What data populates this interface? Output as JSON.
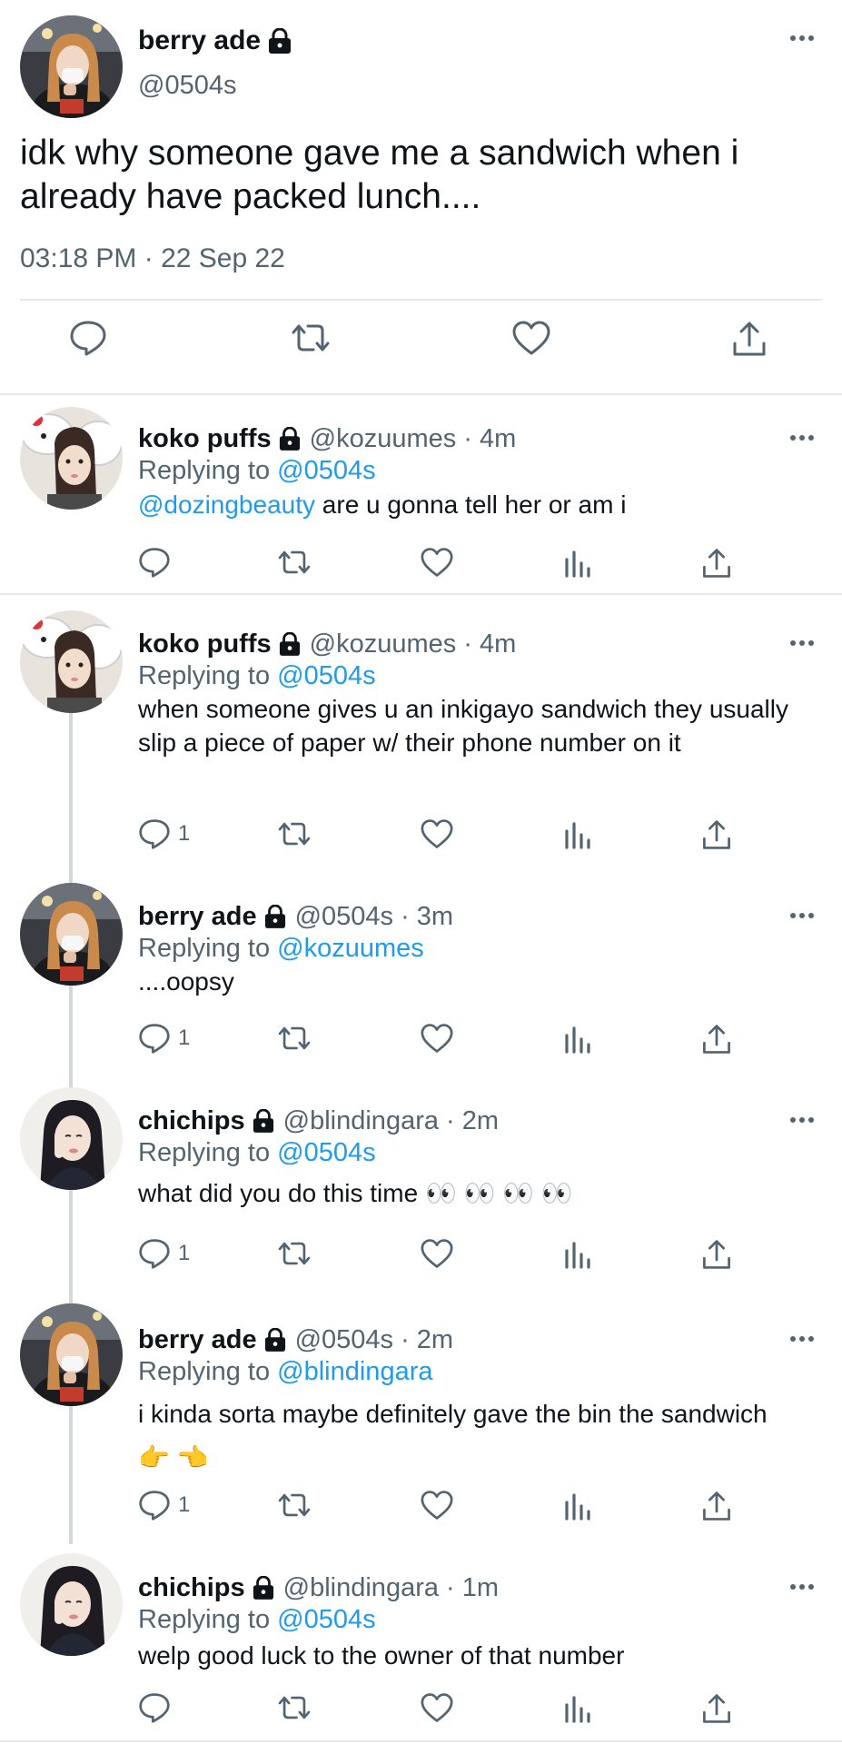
{
  "main_tweet": {
    "name": "berry ade",
    "handle": "@0504s",
    "text": "idk why someone gave me a sandwich when i already have packed lunch....",
    "timestamp": "03:18 PM · 22 Sep 22"
  },
  "replies": [
    {
      "name": "koko puffs",
      "meta": "@kozuumes · 4m",
      "replying_prefix": "Replying to",
      "replying_to": "@0504s",
      "mention": "@dozingbeauty",
      "text": " are u gonna tell her or am i",
      "reply_count": ""
    },
    {
      "name": "koko puffs",
      "meta": "@kozuumes · 4m",
      "replying_prefix": "Replying to",
      "replying_to": "@0504s",
      "text": "when someone gives u an inkigayo sandwich they usually slip a piece of paper w/ their phone number on it",
      "reply_count": "1"
    },
    {
      "name": "berry ade",
      "meta": "@0504s · 3m",
      "replying_prefix": "Replying to",
      "replying_to": "@kozuumes",
      "text": "....oopsy",
      "reply_count": "1"
    },
    {
      "name": "chichips",
      "meta": "@blindingara · 2m",
      "replying_prefix": "Replying to",
      "replying_to": "@0504s",
      "text": "what did you do this time 👀 👀 👀 👀",
      "reply_count": "1"
    },
    {
      "name": "berry ade",
      "meta": "@0504s · 2m",
      "replying_prefix": "Replying to",
      "replying_to": "@blindingara",
      "text": "i kinda sorta maybe definitely gave the bin the sandwich 👉 👈",
      "reply_count": "1"
    },
    {
      "name": "chichips",
      "meta": "@blindingara · 1m",
      "replying_prefix": "Replying to",
      "replying_to": "@0504s",
      "text": "welp good luck to the owner of that number",
      "reply_count": ""
    }
  ],
  "icons": [
    "lock-icon",
    "more-icon",
    "reply-icon",
    "retweet-icon",
    "like-icon",
    "views-icon",
    "share-icon"
  ],
  "colors": {
    "link": "#1d9bf0",
    "secondary_text": "#536471",
    "primary_text": "#0f1419",
    "divider": "#e6e8ea"
  }
}
